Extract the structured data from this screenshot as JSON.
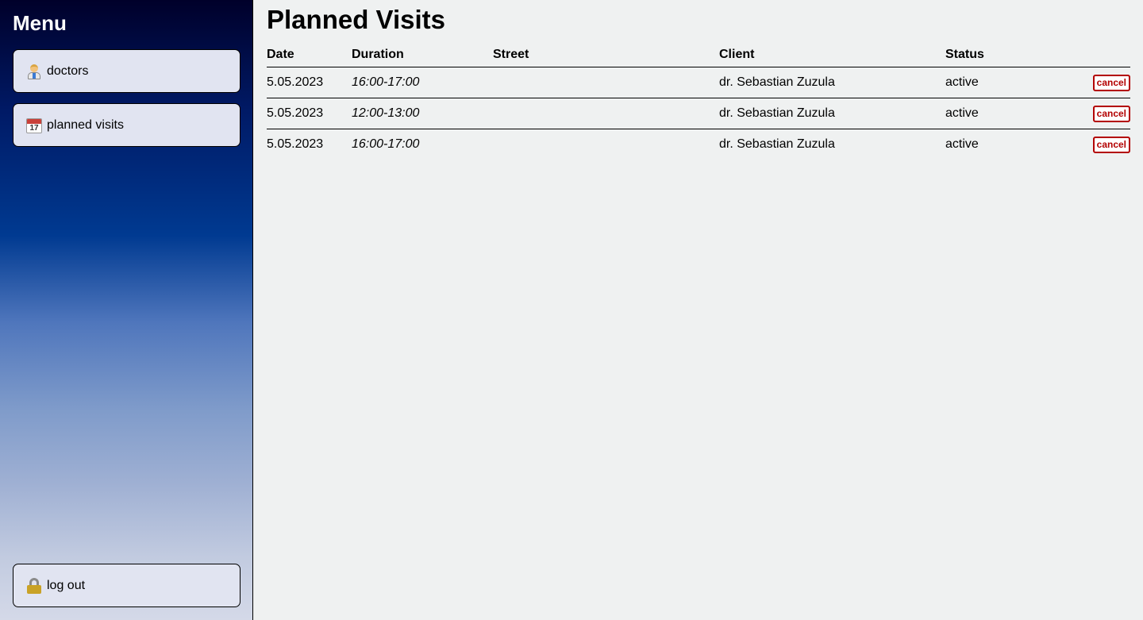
{
  "sidebar": {
    "title": "Menu",
    "items": [
      {
        "label": "doctors",
        "icon": "doctor-icon"
      },
      {
        "label": "planned visits",
        "icon": "calendar-icon",
        "icon_text": "17"
      }
    ],
    "logout": {
      "label": "log out",
      "icon": "lock-icon"
    }
  },
  "main": {
    "title": "Planned Visits",
    "table": {
      "headers": [
        "Date",
        "Duration",
        "Street",
        "Client",
        "Status"
      ],
      "rows": [
        {
          "date": "5.05.2023",
          "duration": "16:00-17:00",
          "street": "",
          "client": "dr. Sebastian Zuzula",
          "status": "active",
          "action": "cancel"
        },
        {
          "date": "5.05.2023",
          "duration": "12:00-13:00",
          "street": "",
          "client": "dr. Sebastian Zuzula",
          "status": "active",
          "action": "cancel"
        },
        {
          "date": "5.05.2023",
          "duration": "16:00-17:00",
          "street": "",
          "client": "dr. Sebastian Zuzula",
          "status": "active",
          "action": "cancel"
        }
      ]
    }
  },
  "colors": {
    "cancel": "#b30000",
    "background": "#eff1f1",
    "nav_button": "#e1e4f1"
  }
}
